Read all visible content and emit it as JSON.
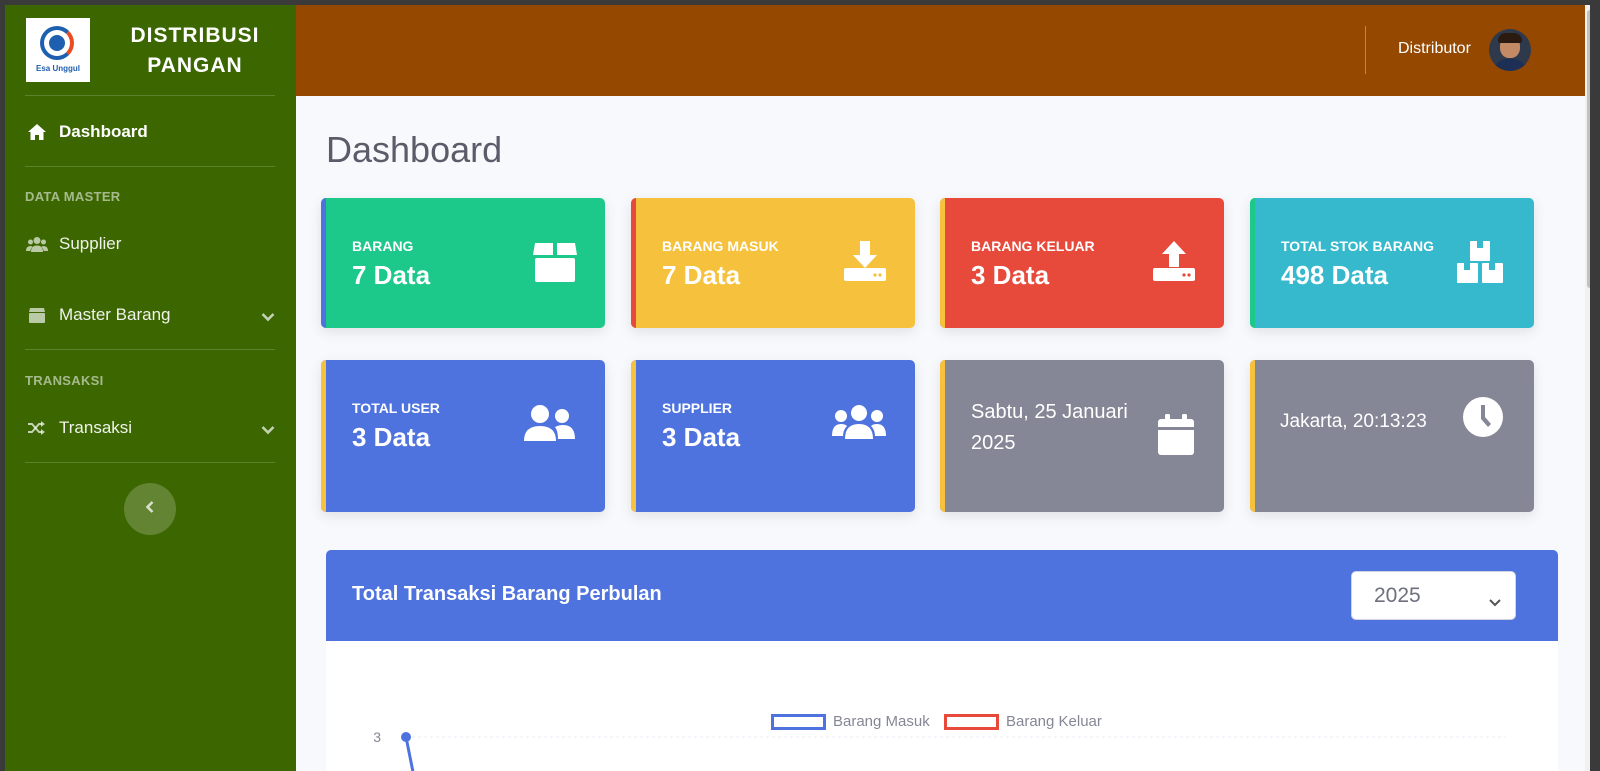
{
  "brand": {
    "logo_text": "Esa Unggul",
    "title_line1": "DISTRIBUSI",
    "title_line2": "PANGAN"
  },
  "sidebar": {
    "items": [
      {
        "label": "Dashboard",
        "icon": "home-icon"
      },
      {
        "label": "Supplier",
        "icon": "users-icon"
      },
      {
        "label": "Master Barang",
        "icon": "box-icon"
      },
      {
        "label": "Transaksi",
        "icon": "shuffle-icon"
      }
    ],
    "sections": [
      "DATA MASTER",
      "TRANSAKSI"
    ]
  },
  "topbar": {
    "user_name": "Distributor"
  },
  "page_title": "Dashboard",
  "cards": [
    {
      "label": "BARANG",
      "value": "7 Data",
      "color": "#1cc88a",
      "strip": "#4e73df",
      "icon": "box-open-icon"
    },
    {
      "label": "BARANG MASUK",
      "value": "7 Data",
      "color": "#f6c23e",
      "strip": "#e74a3b",
      "icon": "download-icon"
    },
    {
      "label": "BARANG KELUAR",
      "value": "3 Data",
      "color": "#e74a3b",
      "strip": "#f6c23e",
      "icon": "upload-icon"
    },
    {
      "label": "TOTAL STOK BARANG",
      "value": "498 Data",
      "color": "#36b9cc",
      "strip": "#1cc88a",
      "icon": "boxes-icon"
    },
    {
      "label": "TOTAL USER",
      "value": "3 Data",
      "color": "#4e73df",
      "strip": "#f6c23e",
      "icon": "user-friends-icon"
    },
    {
      "label": "SUPPLIER",
      "value": "3 Data",
      "color": "#4e73df",
      "strip": "#f6c23e",
      "icon": "users-icon"
    },
    {
      "date_line1": "Sabtu, 25 Januari",
      "date_line2": "2025",
      "color": "#858796",
      "strip": "#f6c23e",
      "icon": "calendar-icon"
    },
    {
      "time_text": "Jakarta, 20:13:23",
      "color": "#858796",
      "strip": "#f6c23e",
      "icon": "clock-icon"
    }
  ],
  "chart_panel": {
    "title": "Total Transaksi Barang Perbulan",
    "selected_year": "2025"
  },
  "chart_data": {
    "type": "line",
    "title": "",
    "series": [
      {
        "name": "Barang Masuk",
        "color": "#4e73df"
      },
      {
        "name": "Barang Keluar",
        "color": "#e74a3b"
      }
    ],
    "y_tick_labels": [
      "3"
    ],
    "first_visible_point": {
      "series": "Barang Masuk",
      "y": 3
    }
  }
}
